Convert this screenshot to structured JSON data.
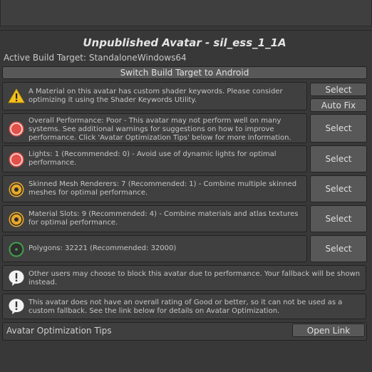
{
  "header": {
    "title": "Unpublished Avatar - sil_ess_1_1A",
    "build_target": "Active Build Target: StandaloneWindows64",
    "switch_button": "Switch Build Target to Android"
  },
  "messages": [
    {
      "icon": "warning-icon",
      "text": "A Material on this avatar has custom shader keywords. Please consider optimizing it using the Shader Keywords Utility.",
      "select": "Select",
      "fix": "Auto Fix"
    },
    {
      "icon": "performance-poor-icon",
      "text": "Overall Performance: Poor - This avatar may not perform well on many systems. See additional warnings for suggestions on how to improve performance. Click 'Avatar Optimization Tips' below for more information.",
      "select": "Select"
    },
    {
      "icon": "performance-poor-icon",
      "text": "Lights: 1 (Recommended: 0) - Avoid use of dynamic lights for optimal performance.",
      "select": "Select"
    },
    {
      "icon": "performance-medium-icon",
      "text": "Skinned Mesh Renderers: 7 (Recommended: 1) - Combine multiple skinned meshes for optimal performance.",
      "select": "Select"
    },
    {
      "icon": "performance-medium-icon",
      "text": "Material Slots: 9 (Recommended: 4) - Combine materials and atlas textures for optimal performance.",
      "select": "Select"
    },
    {
      "icon": "performance-good-icon",
      "text": "Polygons: 32221 (Recommended: 32000)",
      "select": "Select"
    }
  ],
  "info": [
    {
      "icon": "info-icon",
      "text": "Other users may choose to block this avatar due to performance. Your fallback will be shown instead."
    },
    {
      "icon": "info-icon",
      "text": "This avatar does not have an overall rating of Good or better, so it can not be used as a custom fallback. See the link below for details on Avatar Optimization."
    }
  ],
  "tips": {
    "label": "Avatar Optimization Tips",
    "button": "Open Link"
  },
  "colors": {
    "warning": "#f4c01a",
    "poor": "#e2514a",
    "medium": "#e7a82a",
    "good": "#3fa34d"
  }
}
